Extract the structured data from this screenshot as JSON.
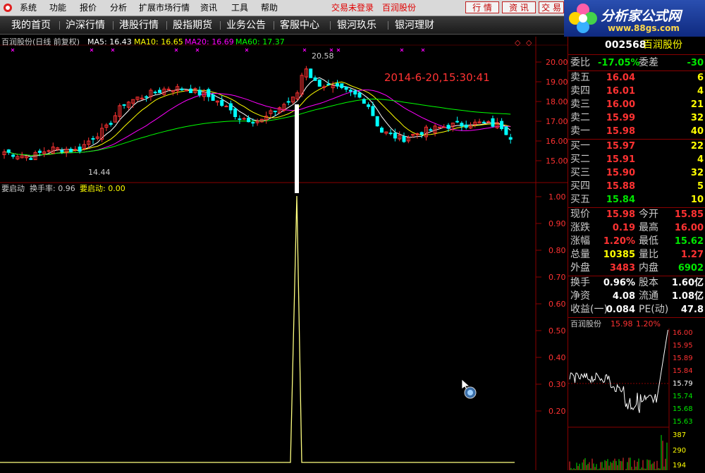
{
  "menu": {
    "items": [
      "系统",
      "功能",
      "报价",
      "分析",
      "扩展市场行情",
      "资讯",
      "工具",
      "帮助"
    ],
    "status_login": "交易未登录",
    "status_stock": "百润股份",
    "btn_quote": "行 情",
    "btn_news": "资 讯",
    "btn_trade": "交 易"
  },
  "nav": {
    "items": [
      "我的首页",
      "沪深行情",
      "港股行情",
      "股指期货",
      "业务公告",
      "客服中心",
      "银河玖乐",
      "银河理财"
    ]
  },
  "brand": {
    "name": "分析家公式网",
    "url": "www.88gs.com"
  },
  "chart": {
    "header_title": "百润股份(日线 前复权)",
    "ma5": "MA5: 16.43",
    "ma10": "MA10: 16.65",
    "ma20": "MA20: 16.69",
    "ma60": "MA60: 17.37",
    "datetime": "2014-6-20,15:30:41",
    "high_label": "20.58",
    "low_label": "14.44",
    "price_ticks": [
      "20.00",
      "19.00",
      "18.00",
      "17.00",
      "16.00",
      "15.00"
    ],
    "indicator_title": "要启动",
    "turnover": "换手率: 0.96",
    "indicator_value": "要启动: 0.00",
    "ind_ticks": [
      "1.00",
      "0.90",
      "0.80",
      "0.70",
      "0.60",
      "0.50",
      "0.40",
      "0.30",
      "0.20"
    ]
  },
  "colors": {
    "up": "#ff3232",
    "down": "#00ffff",
    "ma5": "#ffffff",
    "ma10": "#ffff00",
    "ma20": "#ff00ff",
    "ma60": "#00ff00",
    "grid": "#8a0000"
  },
  "quote": {
    "code": "002568",
    "name": "百润股份",
    "weibi_label": "委比",
    "weibi_value": "-17.05%",
    "weicha_label": "委差",
    "weicha_value": "-30",
    "sell": [
      {
        "label": "卖五",
        "price": "16.04",
        "vol": "6"
      },
      {
        "label": "卖四",
        "price": "16.01",
        "vol": "4"
      },
      {
        "label": "卖三",
        "price": "16.00",
        "vol": "21"
      },
      {
        "label": "卖二",
        "price": "15.99",
        "vol": "32"
      },
      {
        "label": "卖一",
        "price": "15.98",
        "vol": "40"
      }
    ],
    "buy": [
      {
        "label": "买一",
        "price": "15.97",
        "vol": "22"
      },
      {
        "label": "买二",
        "price": "15.91",
        "vol": "4"
      },
      {
        "label": "买三",
        "price": "15.90",
        "vol": "32"
      },
      {
        "label": "买四",
        "price": "15.88",
        "vol": "5"
      },
      {
        "label": "买五",
        "price": "15.84",
        "vol": "10"
      }
    ],
    "stats": [
      {
        "l1": "现价",
        "v1": "15.98",
        "c1": "red",
        "l2": "今开",
        "v2": "15.85",
        "c2": "red"
      },
      {
        "l1": "涨跌",
        "v1": "0.19",
        "c1": "red",
        "l2": "最高",
        "v2": "16.00",
        "c2": "red"
      },
      {
        "l1": "涨幅",
        "v1": "1.20%",
        "c1": "red",
        "l2": "最低",
        "v2": "15.62",
        "c2": "green"
      },
      {
        "l1": "总量",
        "v1": "10385",
        "c1": "yellow",
        "l2": "量比",
        "v2": "1.27",
        "c2": "red"
      },
      {
        "l1": "外盘",
        "v1": "3483",
        "c1": "red",
        "l2": "内盘",
        "v2": "6902",
        "c2": "green"
      }
    ],
    "stats2": [
      {
        "l1": "换手",
        "v1": "0.96%",
        "l2": "股本",
        "v2": "1.60亿"
      },
      {
        "l1": "净资",
        "v1": "4.08",
        "l2": "流通",
        "v2": "1.08亿"
      },
      {
        "l1": "收益(一)",
        "v1": "0.084",
        "l2": "PE(动)",
        "v2": "47.8"
      }
    ],
    "mini_title": "百润股份",
    "mini_price": "15.98",
    "mini_pct": "1.20%",
    "mini_ticks": [
      "16.00",
      "15.95",
      "15.89",
      "15.84",
      "15.79",
      "15.74",
      "15.68",
      "15.63"
    ],
    "mini_vol_ticks": [
      "387",
      "290",
      "194"
    ]
  }
}
